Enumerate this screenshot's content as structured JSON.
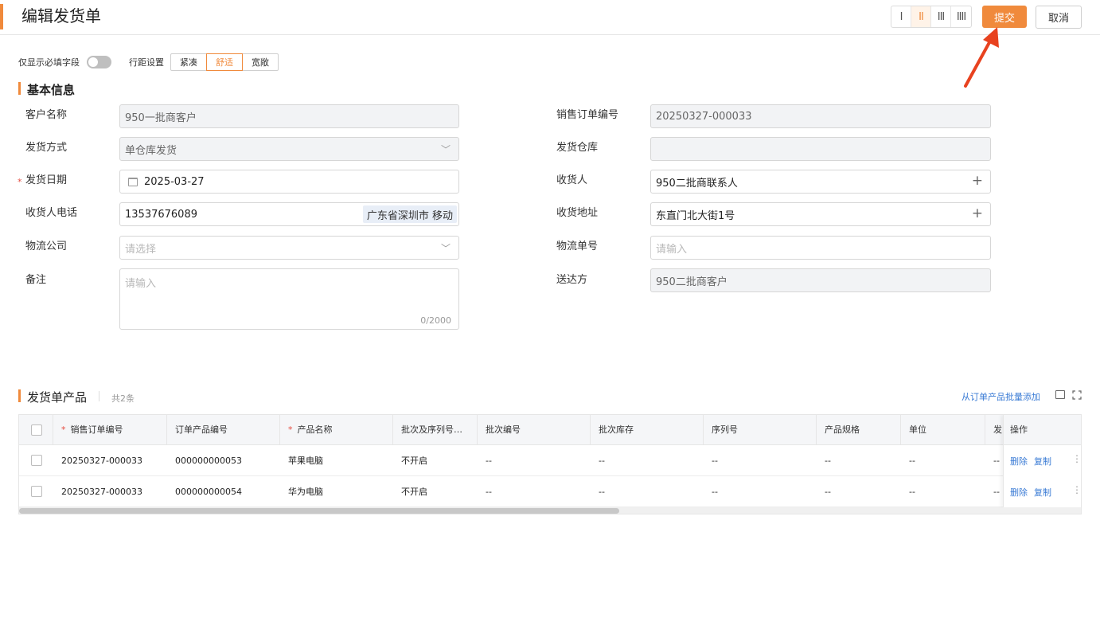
{
  "header": {
    "title": "编辑发货单",
    "layout_options": [
      "I",
      "II",
      "III",
      "IIII"
    ],
    "active_layout": 1,
    "submit_label": "提交",
    "cancel_label": "取消",
    "accent_color": "#f08a3c"
  },
  "toolbar": {
    "required_only_label": "仅显示必填字段",
    "required_only_on": false,
    "spacing_label": "行距设置",
    "spacing_options": [
      "紧凑",
      "舒适",
      "宽敞"
    ],
    "spacing_active": 1
  },
  "basic": {
    "section_title": "基本信息",
    "customer_label": "客户名称",
    "customer_value": "950一批商客户",
    "ship_method_label": "发货方式",
    "ship_method_value": "单仓库发货",
    "ship_date_label": "发货日期",
    "ship_date_value": "2025-03-27",
    "phone_label": "收货人电话",
    "phone_value": "13537676089",
    "phone_location": "广东省深圳市 移动",
    "logistics_label": "物流公司",
    "logistics_placeholder": "请选择",
    "remark_label": "备注",
    "remark_placeholder": "请输入",
    "remark_count": "0/2000",
    "order_no_label": "销售订单编号",
    "order_no_value": "20250327-000033",
    "warehouse_label": "发货仓库",
    "warehouse_value": "",
    "receiver_label": "收货人",
    "receiver_value": "950二批商联系人",
    "address_label": "收货地址",
    "address_value": "东直门北大街1号",
    "tracking_label": "物流单号",
    "tracking_placeholder": "请输入",
    "deliver_to_label": "送达方",
    "deliver_to_value": "950二批商客户"
  },
  "products": {
    "section_title": "发货单产品",
    "count_label": "共2条",
    "batch_add_label": "从订单产品批量添加",
    "columns": [
      "销售订单编号",
      "订单产品编号",
      "产品名称",
      "批次及序列号…",
      "批次编号",
      "批次库存",
      "序列号",
      "产品规格",
      "单位",
      "发"
    ],
    "ops_header": "操作",
    "delete_label": "删除",
    "copy_label": "复制",
    "rows": [
      {
        "order_no": "20250327-000033",
        "item_no": "000000000053",
        "name": "苹果电脑",
        "batch_serial": "不开启",
        "batch_no": "--",
        "batch_stock": "--",
        "serial": "--",
        "spec": "--",
        "unit": "--",
        "ship": "--"
      },
      {
        "order_no": "20250327-000033",
        "item_no": "000000000054",
        "name": "华为电脑",
        "batch_serial": "不开启",
        "batch_no": "--",
        "batch_stock": "--",
        "serial": "--",
        "spec": "--",
        "unit": "--",
        "ship": "--"
      }
    ]
  }
}
